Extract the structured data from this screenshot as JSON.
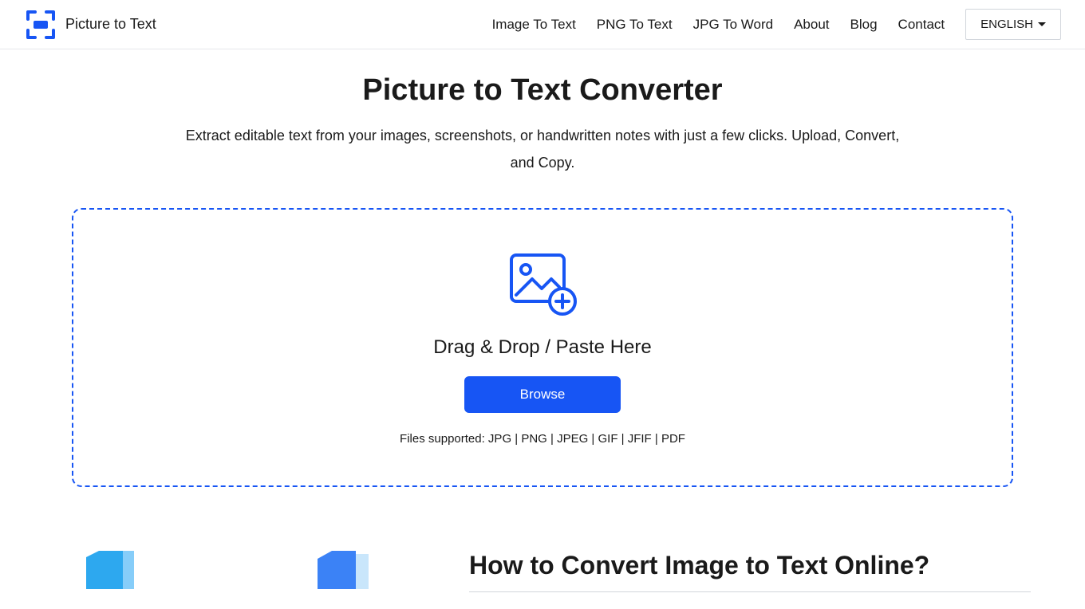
{
  "header": {
    "brand": "Picture to Text",
    "nav": {
      "image_to_text": "Image To Text",
      "png_to_text": "PNG To Text",
      "jpg_to_word": "JPG To Word",
      "about": "About",
      "blog": "Blog",
      "contact": "Contact"
    },
    "language": "ENGLISH"
  },
  "hero": {
    "title": "Picture to Text Converter",
    "subtitle": "Extract editable text from your images, screenshots, or handwritten notes with just a few clicks. Upload, Convert, and Copy."
  },
  "dropzone": {
    "drag_label": "Drag & Drop / Paste Here",
    "browse_label": "Browse",
    "supported_label": "Files supported: JPG | PNG | JPEG | GIF | JFIF | PDF"
  },
  "how": {
    "title": "How to Convert Image to Text Online?"
  },
  "colors": {
    "primary": "#1755f4"
  }
}
